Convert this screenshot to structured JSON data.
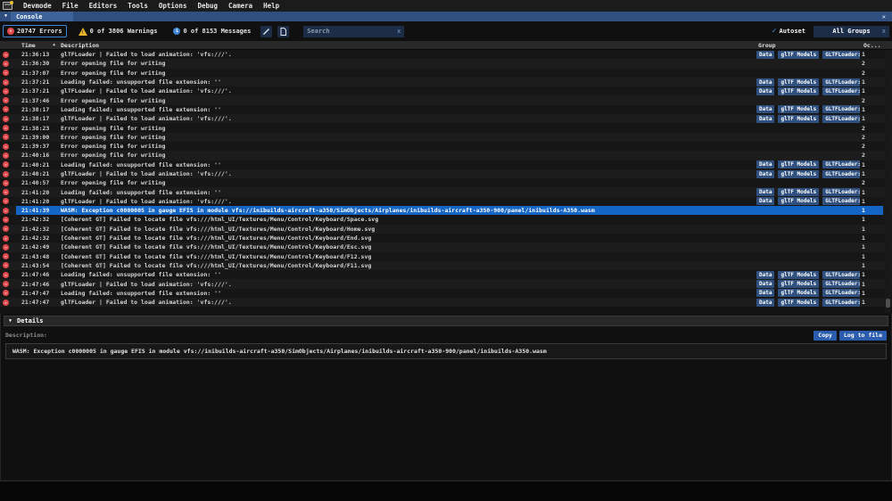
{
  "colors": {
    "titlebar": "#2e4f80",
    "tab": "#3d639a",
    "navy_button": "#1d2d47",
    "badge": "#30517f",
    "highlight": "#1565c4",
    "error": "#e14b4e",
    "warning": "#e9b42c",
    "info": "#3f87d6",
    "action_button": "#2b5cad"
  },
  "icons": {
    "collapse": "▼",
    "close": "✕",
    "error_glyph": "✕",
    "warning_glyph": "!",
    "info_glyph": "i",
    "sort_asc": "▲",
    "check": "✓",
    "search_clear": "x",
    "groups_clear": "x"
  },
  "menu": {
    "items": [
      "Devmode",
      "File",
      "Editors",
      "Tools",
      "Options",
      "Debug",
      "Camera",
      "Help"
    ]
  },
  "console_bar": {
    "title": "Console"
  },
  "toolbar": {
    "errors_label": "20747 Errors",
    "warnings_label": "0 of 3806 Warnings",
    "messages_label": "0 of 8153 Messages",
    "search_placeholder": "Search",
    "autoset_label": "Autoset",
    "groups_label": "All Groups"
  },
  "table": {
    "columns": {
      "time": "Time",
      "description": "Description",
      "group": "Group",
      "occurrences": "Oc..."
    },
    "badge_labels": [
      "Data",
      "glTF Models",
      "GLTFLoader:"
    ],
    "rows": [
      {
        "time": "21:36:13",
        "description": "glTFLoader | Failed to load animation: 'vfs:///'.",
        "badges": true,
        "count": "1",
        "highlighted": false
      },
      {
        "time": "21:36:30",
        "description": "Error opening file for writing",
        "badges": false,
        "count": "2",
        "highlighted": false
      },
      {
        "time": "21:37:07",
        "description": "Error opening file for writing",
        "badges": false,
        "count": "2",
        "highlighted": false
      },
      {
        "time": "21:37:21",
        "description": "Loading failed: unsupported file extension: ''",
        "badges": true,
        "count": "1",
        "highlighted": false
      },
      {
        "time": "21:37:21",
        "description": "glTFLoader | Failed to load animation: 'vfs:///'.",
        "badges": true,
        "count": "1",
        "highlighted": false
      },
      {
        "time": "21:37:46",
        "description": "Error opening file for writing",
        "badges": false,
        "count": "2",
        "highlighted": false
      },
      {
        "time": "21:38:17",
        "description": "Loading failed: unsupported file extension: ''",
        "badges": true,
        "count": "1",
        "highlighted": false
      },
      {
        "time": "21:38:17",
        "description": "glTFLoader | Failed to load animation: 'vfs:///'.",
        "badges": true,
        "count": "1",
        "highlighted": false
      },
      {
        "time": "21:38:23",
        "description": "Error opening file for writing",
        "badges": false,
        "count": "2",
        "highlighted": false
      },
      {
        "time": "21:39:00",
        "description": "Error opening file for writing",
        "badges": false,
        "count": "2",
        "highlighted": false
      },
      {
        "time": "21:39:37",
        "description": "Error opening file for writing",
        "badges": false,
        "count": "2",
        "highlighted": false
      },
      {
        "time": "21:40:16",
        "description": "Error opening file for writing",
        "badges": false,
        "count": "2",
        "highlighted": false
      },
      {
        "time": "21:40:21",
        "description": "Loading failed: unsupported file extension: ''",
        "badges": true,
        "count": "1",
        "highlighted": false
      },
      {
        "time": "21:40:21",
        "description": "glTFLoader | Failed to load animation: 'vfs:///'.",
        "badges": true,
        "count": "1",
        "highlighted": false
      },
      {
        "time": "21:40:57",
        "description": "Error opening file for writing",
        "badges": false,
        "count": "2",
        "highlighted": false
      },
      {
        "time": "21:41:20",
        "description": "Loading failed: unsupported file extension: ''",
        "badges": true,
        "count": "1",
        "highlighted": false
      },
      {
        "time": "21:41:20",
        "description": "glTFLoader | Failed to load animation: 'vfs:///'.",
        "badges": true,
        "count": "1",
        "highlighted": false
      },
      {
        "time": "21:41:39",
        "description": "WASM: Exception c0000005 in gauge EFIS in module vfs://inibuilds-aircraft-a350/SimObjects/Airplanes/inibuilds-aircraft-a350-900/panel/inibuilds-A350.wasm",
        "badges": false,
        "count": "1",
        "highlighted": true
      },
      {
        "time": "21:42:32",
        "description": "[Coherent GT] Failed to locate file vfs:///html_UI/Textures/Menu/Control/Keyboard/Space.svg",
        "badges": false,
        "count": "1",
        "highlighted": false
      },
      {
        "time": "21:42:32",
        "description": "[Coherent GT] Failed to locate file vfs:///html_UI/Textures/Menu/Control/Keyboard/Home.svg",
        "badges": false,
        "count": "1",
        "highlighted": false
      },
      {
        "time": "21:42:32",
        "description": "[Coherent GT] Failed to locate file vfs:///html_UI/Textures/Menu/Control/Keyboard/End.svg",
        "badges": false,
        "count": "1",
        "highlighted": false
      },
      {
        "time": "21:42:49",
        "description": "[Coherent GT] Failed to locate file vfs:///html_UI/Textures/Menu/Control/Keyboard/Esc.svg",
        "badges": false,
        "count": "1",
        "highlighted": false
      },
      {
        "time": "21:43:48",
        "description": "[Coherent GT] Failed to locate file vfs:///html_UI/Textures/Menu/Control/Keyboard/F12.svg",
        "badges": false,
        "count": "1",
        "highlighted": false
      },
      {
        "time": "21:43:54",
        "description": "[Coherent GT] Failed to locate file vfs:///html_UI/Textures/Menu/Control/Keyboard/F11.svg",
        "badges": false,
        "count": "1",
        "highlighted": false
      },
      {
        "time": "21:47:46",
        "description": "Loading failed: unsupported file extension: ''",
        "badges": true,
        "count": "1",
        "highlighted": false
      },
      {
        "time": "21:47:46",
        "description": "glTFLoader | Failed to load animation: 'vfs:///'.",
        "badges": true,
        "count": "1",
        "highlighted": false
      },
      {
        "time": "21:47:47",
        "description": "Loading failed: unsupported file extension: ''",
        "badges": true,
        "count": "1",
        "highlighted": false
      },
      {
        "time": "21:47:47",
        "description": "glTFLoader | Failed to load animation: 'vfs:///'.",
        "badges": true,
        "count": "1",
        "highlighted": false
      }
    ]
  },
  "details": {
    "header": "Details",
    "description_label": "Description:",
    "copy_button": "Copy",
    "log_button": "Log to file",
    "text": "WASM: Exception c0000005 in gauge EFIS in module vfs://inibuilds-aircraft-a350/SimObjects/Airplanes/inibuilds-aircraft-a350-900/panel/inibuilds-A350.wasm"
  }
}
